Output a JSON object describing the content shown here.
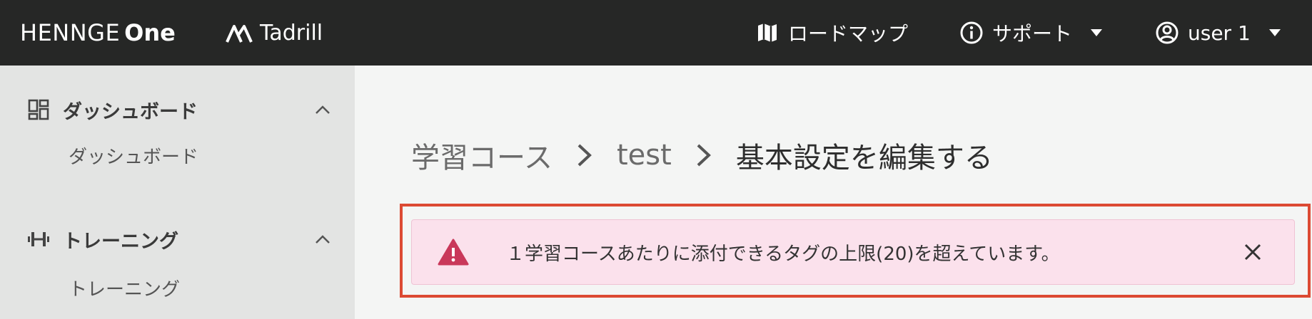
{
  "header": {
    "brand_main": "HENNGE",
    "brand_suffix": "One",
    "product_name": "Tadrill",
    "roadmap_label": "ロードマップ",
    "support_label": "サポート",
    "user_label": "user 1"
  },
  "sidebar": {
    "groups": [
      {
        "label": "ダッシュボード",
        "icon": "dashboard-icon",
        "items": [
          {
            "label": "ダッシュボード"
          }
        ]
      },
      {
        "label": "トレーニング",
        "icon": "dumbbell-icon",
        "items": [
          {
            "label": "トレーニング"
          }
        ]
      }
    ]
  },
  "breadcrumb": {
    "items": [
      "学習コース",
      "test"
    ],
    "current": "基本設定を編集する"
  },
  "alert": {
    "message": "１学習コースあたりに添付できるタグの上限(20)を超えています。",
    "highlight_color": "#dc4a33",
    "background_color": "#fbe1ec",
    "icon_color": "#c9385a"
  }
}
